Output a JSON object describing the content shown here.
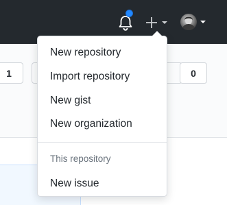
{
  "header": {
    "notifications": {
      "icon": "bell-icon",
      "unread_indicator_color": "#2188ff"
    },
    "create_menu": {
      "icon": "plus-icon",
      "caret_icon": "caret-down-icon"
    },
    "user_menu": {
      "icon": "avatar",
      "caret_icon": "caret-down-icon"
    }
  },
  "background": {
    "left_count": "1",
    "right_count": "0"
  },
  "dropdown": {
    "items": [
      {
        "label": "New repository"
      },
      {
        "label": "Import repository"
      },
      {
        "label": "New gist"
      },
      {
        "label": "New organization"
      }
    ],
    "section_header": "This repository",
    "section_items": [
      {
        "label": "New issue"
      }
    ]
  }
}
